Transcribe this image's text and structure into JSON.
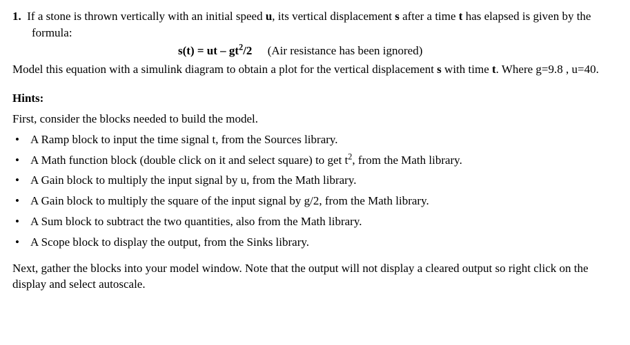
{
  "question": {
    "number_label": "1.",
    "intro_part1": "If a stone is thrown vertically with an initial speed ",
    "var_u": "u",
    "intro_part2": ", its vertical displacement ",
    "var_s": "s",
    "intro_part3": " after a time ",
    "var_t": "t",
    "intro_part4": " has elapsed is given by the formula:",
    "formula_prefix": "s(t) = ut – gt",
    "formula_sup": "2",
    "formula_suffix": "/2",
    "formula_note": "(Air resistance has been ignored)",
    "body1_part1": "Model this equation with a simulink diagram to obtain a plot for the vertical displacement ",
    "body1_var_s": "s",
    "body1_part2": " with time ",
    "body1_var_t": "t",
    "body1_part3": ". Where g=9.8 , u=40."
  },
  "hints": {
    "heading": "Hints:",
    "intro": "First, consider the blocks needed to build the model.",
    "items": [
      {
        "pre": "A Ramp block to input the time signal t, from the Sources library.",
        "has_sup": false
      },
      {
        "pre": "A Math function block (double click on it and select square) to get t",
        "sup": "2",
        "post": ", from the Math library.",
        "has_sup": true
      },
      {
        "pre": "A Gain block to multiply the input signal by u, from the Math library.",
        "has_sup": false
      },
      {
        "pre": "A Gain block to multiply the square of the input signal by g/2, from the Math library.",
        "has_sup": false
      },
      {
        "pre": "A Sum block to subtract the two quantities, also from the Math library.",
        "has_sup": false
      },
      {
        "pre": "A Scope block to display the output, from the Sinks library.",
        "has_sup": false
      }
    ],
    "closing": "Next, gather the blocks into your model window. Note that the output will not display a cleared output so right click on the display and select autoscale."
  },
  "glyphs": {
    "bullet": "•"
  }
}
